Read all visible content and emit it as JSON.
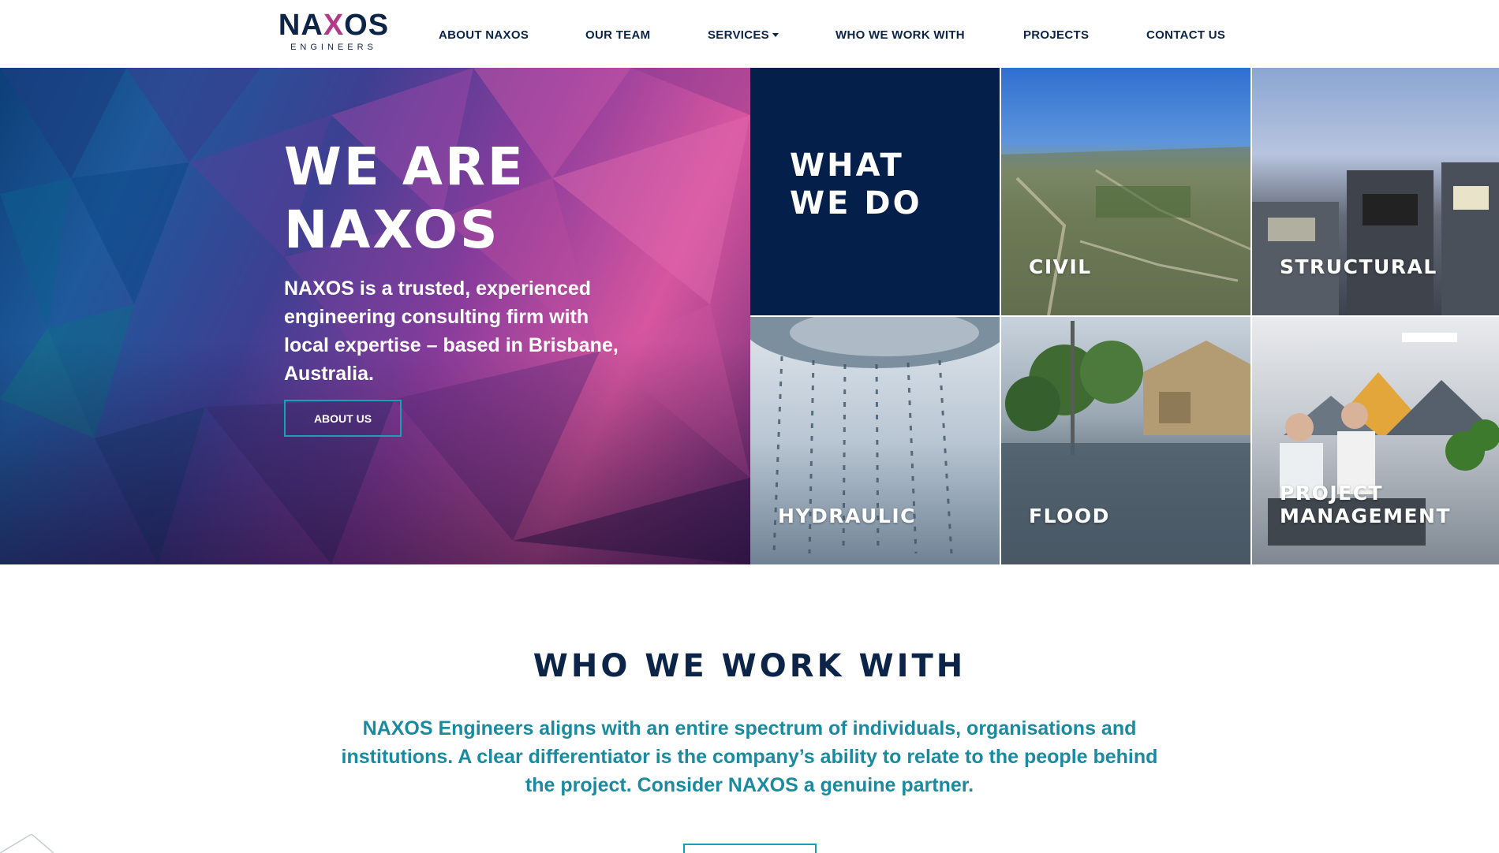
{
  "header": {
    "logo_text": "NAXOS",
    "logo_subtext": "ENGINEERS",
    "nav": [
      {
        "label": "ABOUT NAXOS"
      },
      {
        "label": "OUR TEAM"
      },
      {
        "label": "SERVICES"
      },
      {
        "label": "WHO WE WORK WITH"
      },
      {
        "label": "PROJECTS"
      },
      {
        "label": "CONTACT US"
      }
    ]
  },
  "hero": {
    "title_line1": "WE ARE",
    "title_line2": "NAXOS",
    "description": "NAXOS is a trusted, experienced engineering consulting firm with local expertise – based in Brisbane, Australia.",
    "button_label": "ABOUT US"
  },
  "services": {
    "what_title_line1": "WHAT",
    "what_title_line2": "WE DO",
    "tiles": [
      {
        "label": "CIVIL"
      },
      {
        "label": "STRUCTURAL"
      },
      {
        "label": "HYDRAULIC"
      },
      {
        "label": "FLOOD"
      },
      {
        "label_line1": "PROJECT",
        "label_line2": "MANAGEMENT"
      }
    ]
  },
  "who_we_work_with": {
    "title": "WHO WE WORK WITH",
    "text": "NAXOS Engineers aligns with an entire spectrum of individuals, organisations and institutions. A clear differentiator is the company’s ability to relate to the people behind the project. Consider NAXOS a genuine partner."
  },
  "colors": {
    "navy": "#0b2447",
    "teal": "#1a8aa0",
    "accent_magenta": "#b33a86",
    "what_we_do_bg": "#04204a"
  }
}
